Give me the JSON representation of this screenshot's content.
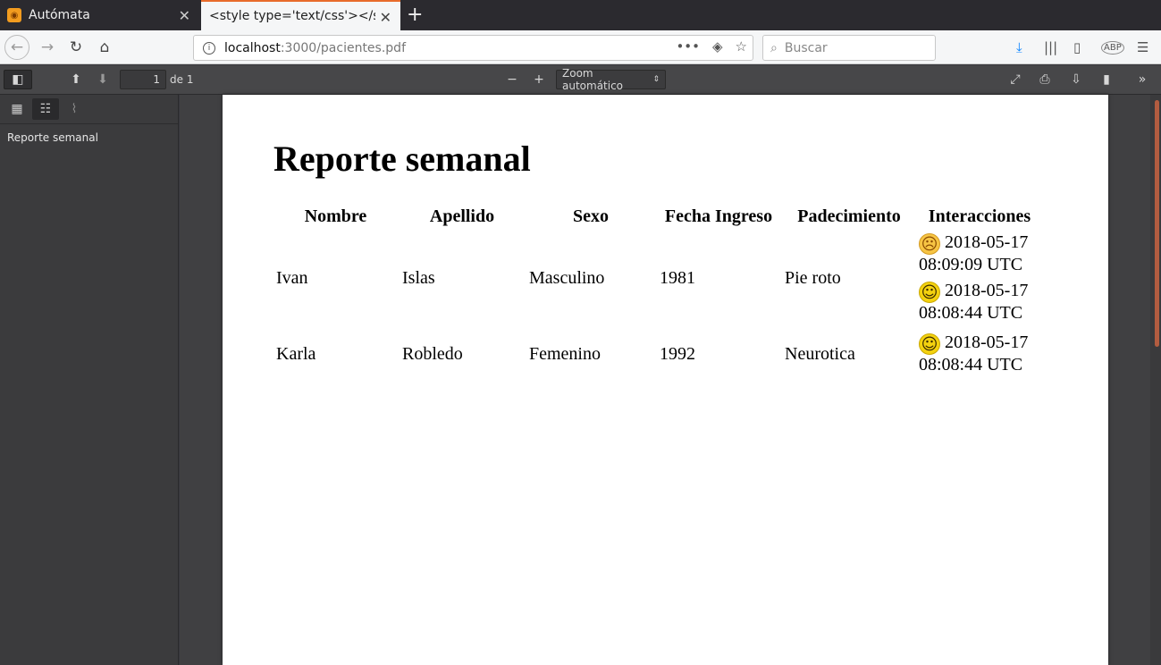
{
  "tabs": [
    {
      "title": "Autómata",
      "active": false
    },
    {
      "title": "<style type='text/css'></st",
      "active": true
    }
  ],
  "nav": {
    "url_host": "localhost",
    "url_rest": ":3000/pacientes.pdf",
    "search_placeholder": "Buscar"
  },
  "pdf_toolbar": {
    "page_number": "1",
    "page_of": "de 1",
    "zoom": "Zoom automático"
  },
  "sidebar": {
    "outline": [
      "Reporte semanal"
    ]
  },
  "document": {
    "title": "Reporte semanal",
    "headers": [
      "Nombre",
      "Apellido",
      "Sexo",
      "Fecha Ingreso",
      "Padecimiento",
      "Interacciones"
    ],
    "rows": [
      {
        "nombre": "Ivan",
        "apellido": "Islas",
        "sexo": "Masculino",
        "fecha": "1981",
        "padecimiento": "Pie roto",
        "interacciones": [
          {
            "emoji": "sad-face-icon",
            "date": "2018-05-17",
            "time": "08:09:09 UTC"
          },
          {
            "emoji": "happy-face-icon",
            "date": "2018-05-17",
            "time": "08:08:44 UTC"
          }
        ]
      },
      {
        "nombre": "Karla",
        "apellido": "Robledo",
        "sexo": "Femenino",
        "fecha": "1992",
        "padecimiento": "Neurotica",
        "interacciones": [
          {
            "emoji": "happy-face-icon",
            "date": "2018-05-17",
            "time": "08:08:44 UTC"
          }
        ]
      }
    ]
  },
  "colors": {
    "accent": "#e86b2b",
    "download": "#0a84ff",
    "viewer_bg": "#404042"
  }
}
